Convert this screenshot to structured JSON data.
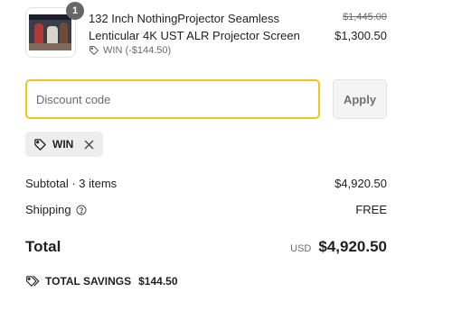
{
  "line_item": {
    "quantity": "1",
    "title": "132 Inch NothingProjector Seamless Lenticular 4K UST ALR Projector Screen",
    "discount_text": "WIN (-$144.50)",
    "original_price": "$1,445.00",
    "price": "$1,300.50",
    "icon": "tag-icon"
  },
  "discount": {
    "placeholder": "Discount code",
    "value": "",
    "apply_label": "Apply",
    "accent_color": "#f2c417",
    "applied_code": "WIN"
  },
  "summary": {
    "subtotal_label": "Subtotal · 3 items",
    "subtotal_value": "$4,920.50",
    "shipping_label": "Shipping",
    "shipping_value": "FREE",
    "total_label": "Total",
    "currency": "USD",
    "total_value": "$4,920.50",
    "savings_label": "TOTAL SAVINGS",
    "savings_value": "$144.50"
  }
}
